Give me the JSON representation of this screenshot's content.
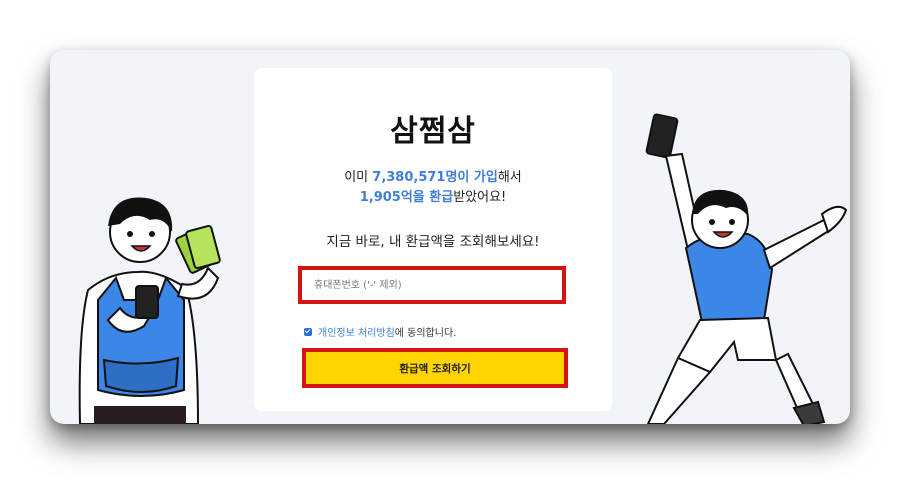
{
  "brand": {
    "logo_text": "삼쩜삼"
  },
  "stats": {
    "line1_prefix": "이미 ",
    "line1_highlight": "7,380,571명이 가입",
    "line1_suffix": "해서",
    "line2_highlight": "1,905억을 환급",
    "line2_suffix": "받았어요!"
  },
  "cta_text": "지금 바로, 내 환급액을 조회해보세요!",
  "phone_input": {
    "placeholder": "휴대폰번호 ('-' 제외)",
    "value": ""
  },
  "consent": {
    "checked": true,
    "link_text": "개인정보 처리방침",
    "suffix": "에 동의합니다."
  },
  "submit_label": "환급액 조회하기",
  "colors": {
    "accent_blue": "#3f7fd9",
    "button_yellow": "#ffd400",
    "highlight_red": "#d41414",
    "background": "#f1f5f9"
  }
}
